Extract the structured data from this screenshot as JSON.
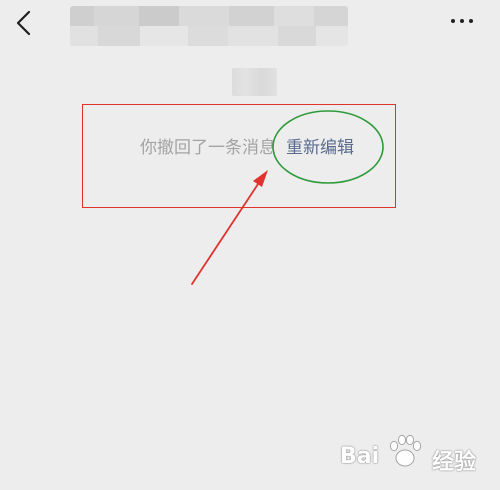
{
  "recall_notice": {
    "message": "你撤回了一条消息",
    "reedit_label": "重新编辑"
  },
  "watermark": {
    "brand": "Bai",
    "brand_suffix": "经验"
  },
  "colors": {
    "background": "#ededed",
    "recall_text": "#a3a3a3",
    "reedit_link": "#5a6b8e",
    "annotation_box": "#e0332e",
    "annotation_ellipse": "#2e9a3a",
    "annotation_arrow": "#e0332e"
  },
  "icons": {
    "back": "chevron-left-icon",
    "more": "more-dots-icon",
    "watermark_paw": "paw-icon"
  }
}
